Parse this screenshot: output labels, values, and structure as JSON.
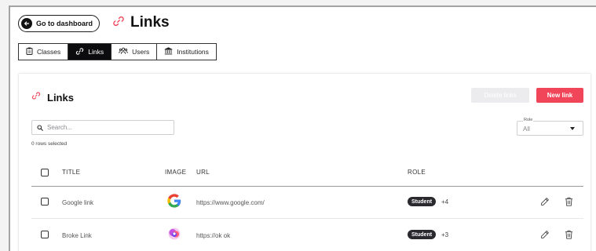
{
  "header": {
    "dashboard_button": "Go to dashboard",
    "title": "Links"
  },
  "tabs": [
    {
      "label": "Classes",
      "icon": "clipboard-icon",
      "active": false
    },
    {
      "label": "Links",
      "icon": "link-icon",
      "active": true
    },
    {
      "label": "Users",
      "icon": "users-icon",
      "active": false
    },
    {
      "label": "Institutions",
      "icon": "institution-icon",
      "active": false
    }
  ],
  "panel": {
    "title": "Links",
    "delete_button": "Delete links",
    "new_button": "New link",
    "search_placeholder": "Search...",
    "rows_selected": "0 rows selected",
    "role_filter": {
      "label": "Role",
      "value": "All"
    }
  },
  "table": {
    "columns": [
      "TITLE",
      "IMAGE",
      "URL",
      "ROLE"
    ],
    "rows": [
      {
        "title": "Google link",
        "image": "google-logo",
        "url": "https://www.google.com/",
        "role": "Student",
        "extra": "+4"
      },
      {
        "title": "Broke Link",
        "image": "broken-image",
        "url": "https://ok ok",
        "role": "Student",
        "extra": "+3"
      }
    ]
  },
  "colors": {
    "accent": "#f1465a",
    "dark": "#0c0c0e",
    "disabled": "#ececee"
  }
}
